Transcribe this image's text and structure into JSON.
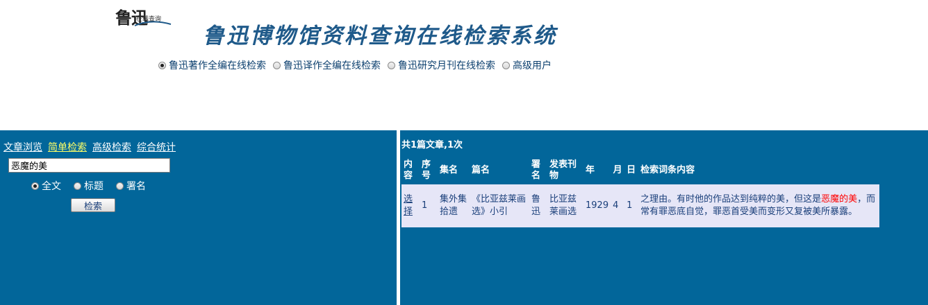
{
  "header": {
    "logo_big": "鲁迅",
    "logo_small": "在线查询",
    "title": "鲁迅博物馆资料查询在线检索系统",
    "databases": [
      {
        "label": "鲁迅著作全编在线检索",
        "checked": true
      },
      {
        "label": "鲁迅译作全编在线检索",
        "checked": false
      },
      {
        "label": "鲁迅研究月刊在线检索",
        "checked": false
      },
      {
        "label": "高级用户",
        "checked": false
      }
    ]
  },
  "left": {
    "nav": [
      "文章浏览",
      "简单检索",
      "高级检索",
      "综合统计"
    ],
    "active_nav": "简单检索",
    "search_value": "恶魔的美",
    "scopes": [
      {
        "label": "全文",
        "checked": true
      },
      {
        "label": "标题",
        "checked": false
      },
      {
        "label": "署名",
        "checked": false
      }
    ],
    "search_button": "检索"
  },
  "right": {
    "result_count": "共1篇文章,1次",
    "columns": [
      "内容",
      "序号",
      "集名",
      "篇名",
      "署名",
      "发表刊物",
      "年",
      "月",
      "日",
      "检索词条内容"
    ],
    "rows": [
      {
        "content_link": "选择",
        "seq": "1",
        "collection": "集外集拾遗",
        "article": "《比亚兹莱画选》小引",
        "author": "鲁迅",
        "publication": "比亚兹莱画选",
        "year": "1929",
        "month": "4",
        "day": "1",
        "snippet_before": "之理由。有时他的作品达到纯粹的美，但这是",
        "snippet_highlight": "恶魔的美",
        "snippet_after": "，而常有罪恶底自觉，罪恶首受美而变形又复被美所暴露。"
      }
    ]
  },
  "colors": {
    "panel_bg": "#02669a",
    "title_color": "#1f5a8a",
    "row_bg": "#e6e6f7",
    "active_nav": "#ffff66",
    "highlight": "#ff0000"
  }
}
